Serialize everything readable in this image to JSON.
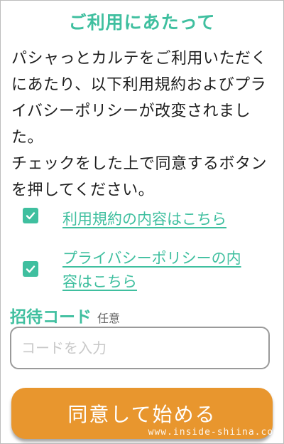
{
  "title": "ご利用にあたって",
  "body": {
    "paragraph1": "パシャっとカルテをご利用いただくにあたり、以下利用規約およびプライバシーポリシーが改変されました。",
    "paragraph2": "チェックをした上で同意するボタンを押してください。"
  },
  "agreements": [
    {
      "label": "利用規約の内容はこちら",
      "checked": true
    },
    {
      "label": "プライバシーポリシーの内容はこちら",
      "checked": true
    }
  ],
  "invite": {
    "label": "招待コード",
    "optional": "任意",
    "placeholder": "コードを入力",
    "value": ""
  },
  "cta_label": "同意して始める",
  "watermark": "www.inside-shiina.com",
  "colors": {
    "accent": "#3fbf9f",
    "button": "#e8962e"
  },
  "icons": {
    "checkbox": "check-icon"
  }
}
